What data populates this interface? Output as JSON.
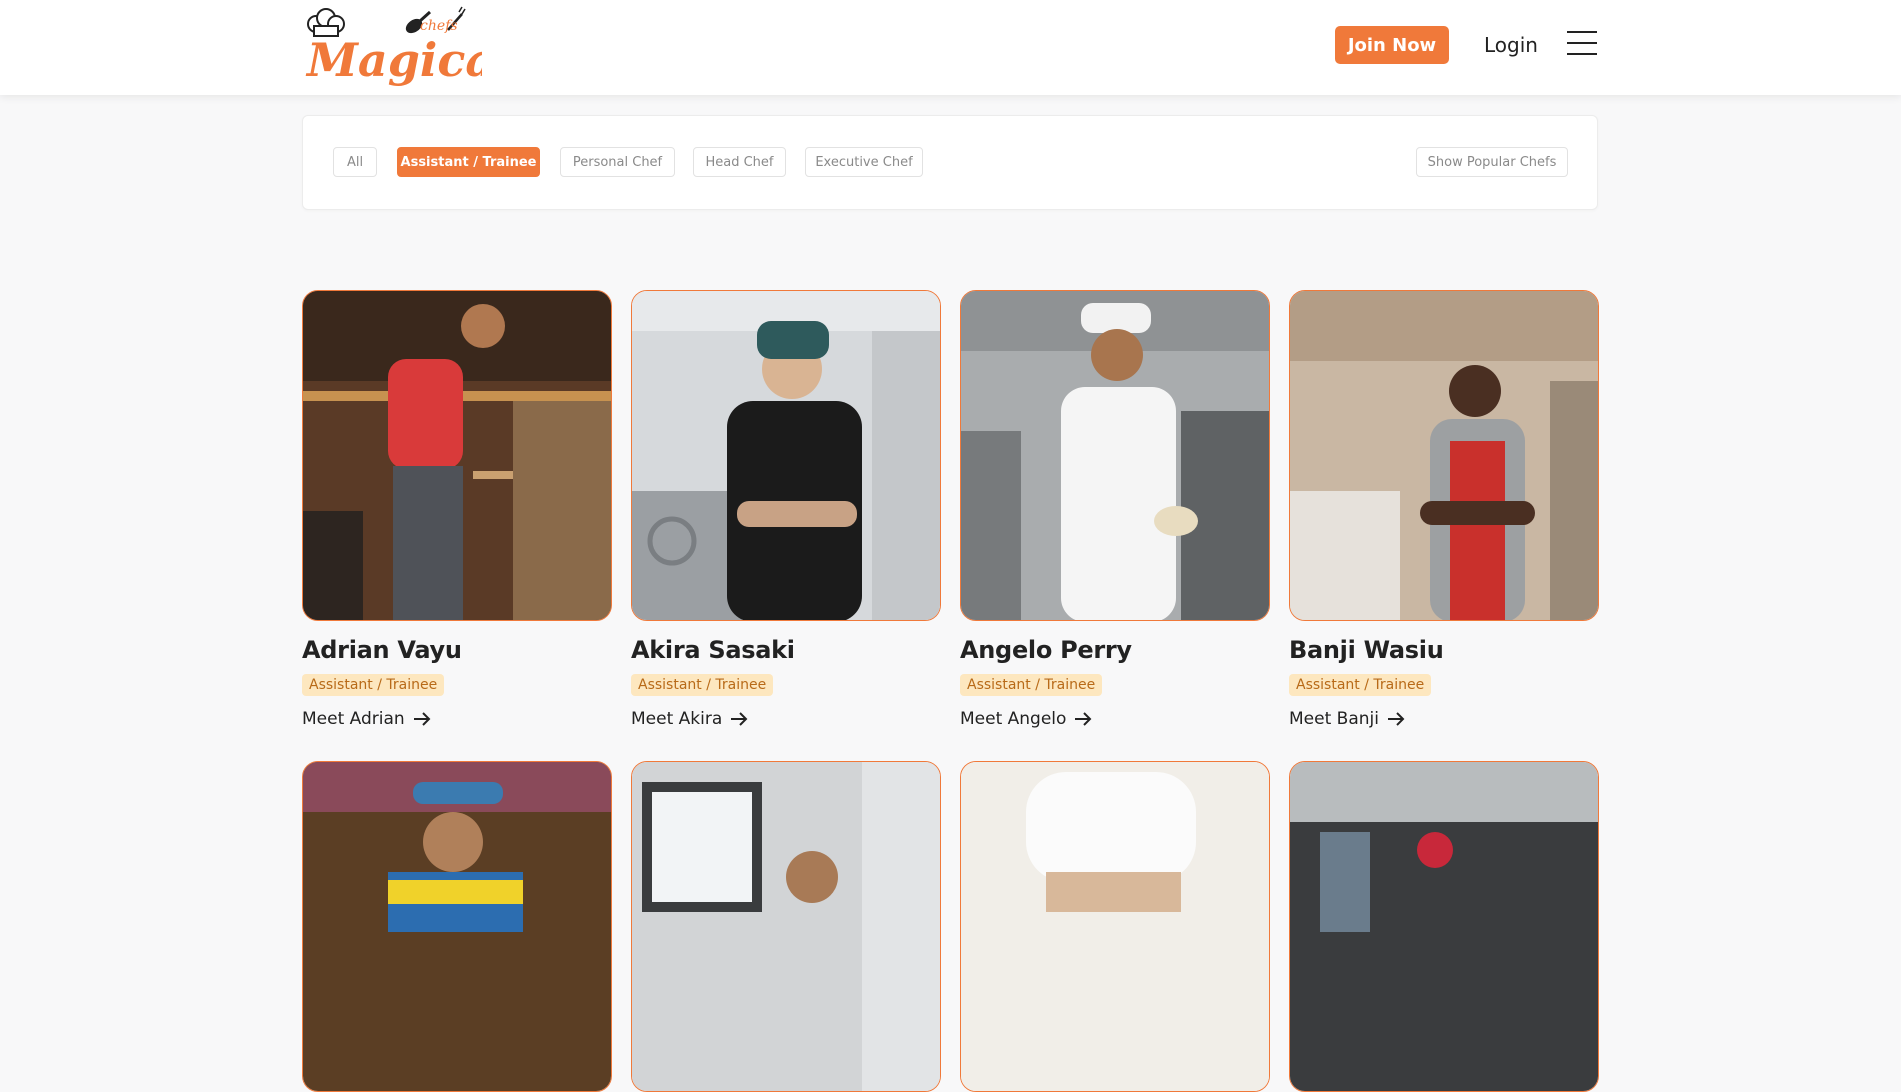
{
  "brand": {
    "logo_main": "Magical",
    "logo_sub": "chefs",
    "accent_color": "#f0793a"
  },
  "header": {
    "join_label": "Join Now",
    "login_label": "Login"
  },
  "filters": {
    "tabs": [
      {
        "label": "All",
        "active": false
      },
      {
        "label": "Assistant / Trainee",
        "active": true
      },
      {
        "label": "Personal Chef",
        "active": false
      },
      {
        "label": "Head Chef",
        "active": false
      },
      {
        "label": "Executive Chef",
        "active": false
      }
    ],
    "popular_label": "Show Popular Chefs"
  },
  "chefs": [
    {
      "name": "Adrian Vayu",
      "role": "Assistant / Trainee",
      "cta": "Meet Adrian"
    },
    {
      "name": "Akira Sasaki",
      "role": "Assistant / Trainee",
      "cta": "Meet Akira"
    },
    {
      "name": "Angelo Perry",
      "role": "Assistant / Trainee",
      "cta": "Meet Angelo"
    },
    {
      "name": "Banji Wasiu",
      "role": "Assistant / Trainee",
      "cta": "Meet Banji"
    }
  ]
}
